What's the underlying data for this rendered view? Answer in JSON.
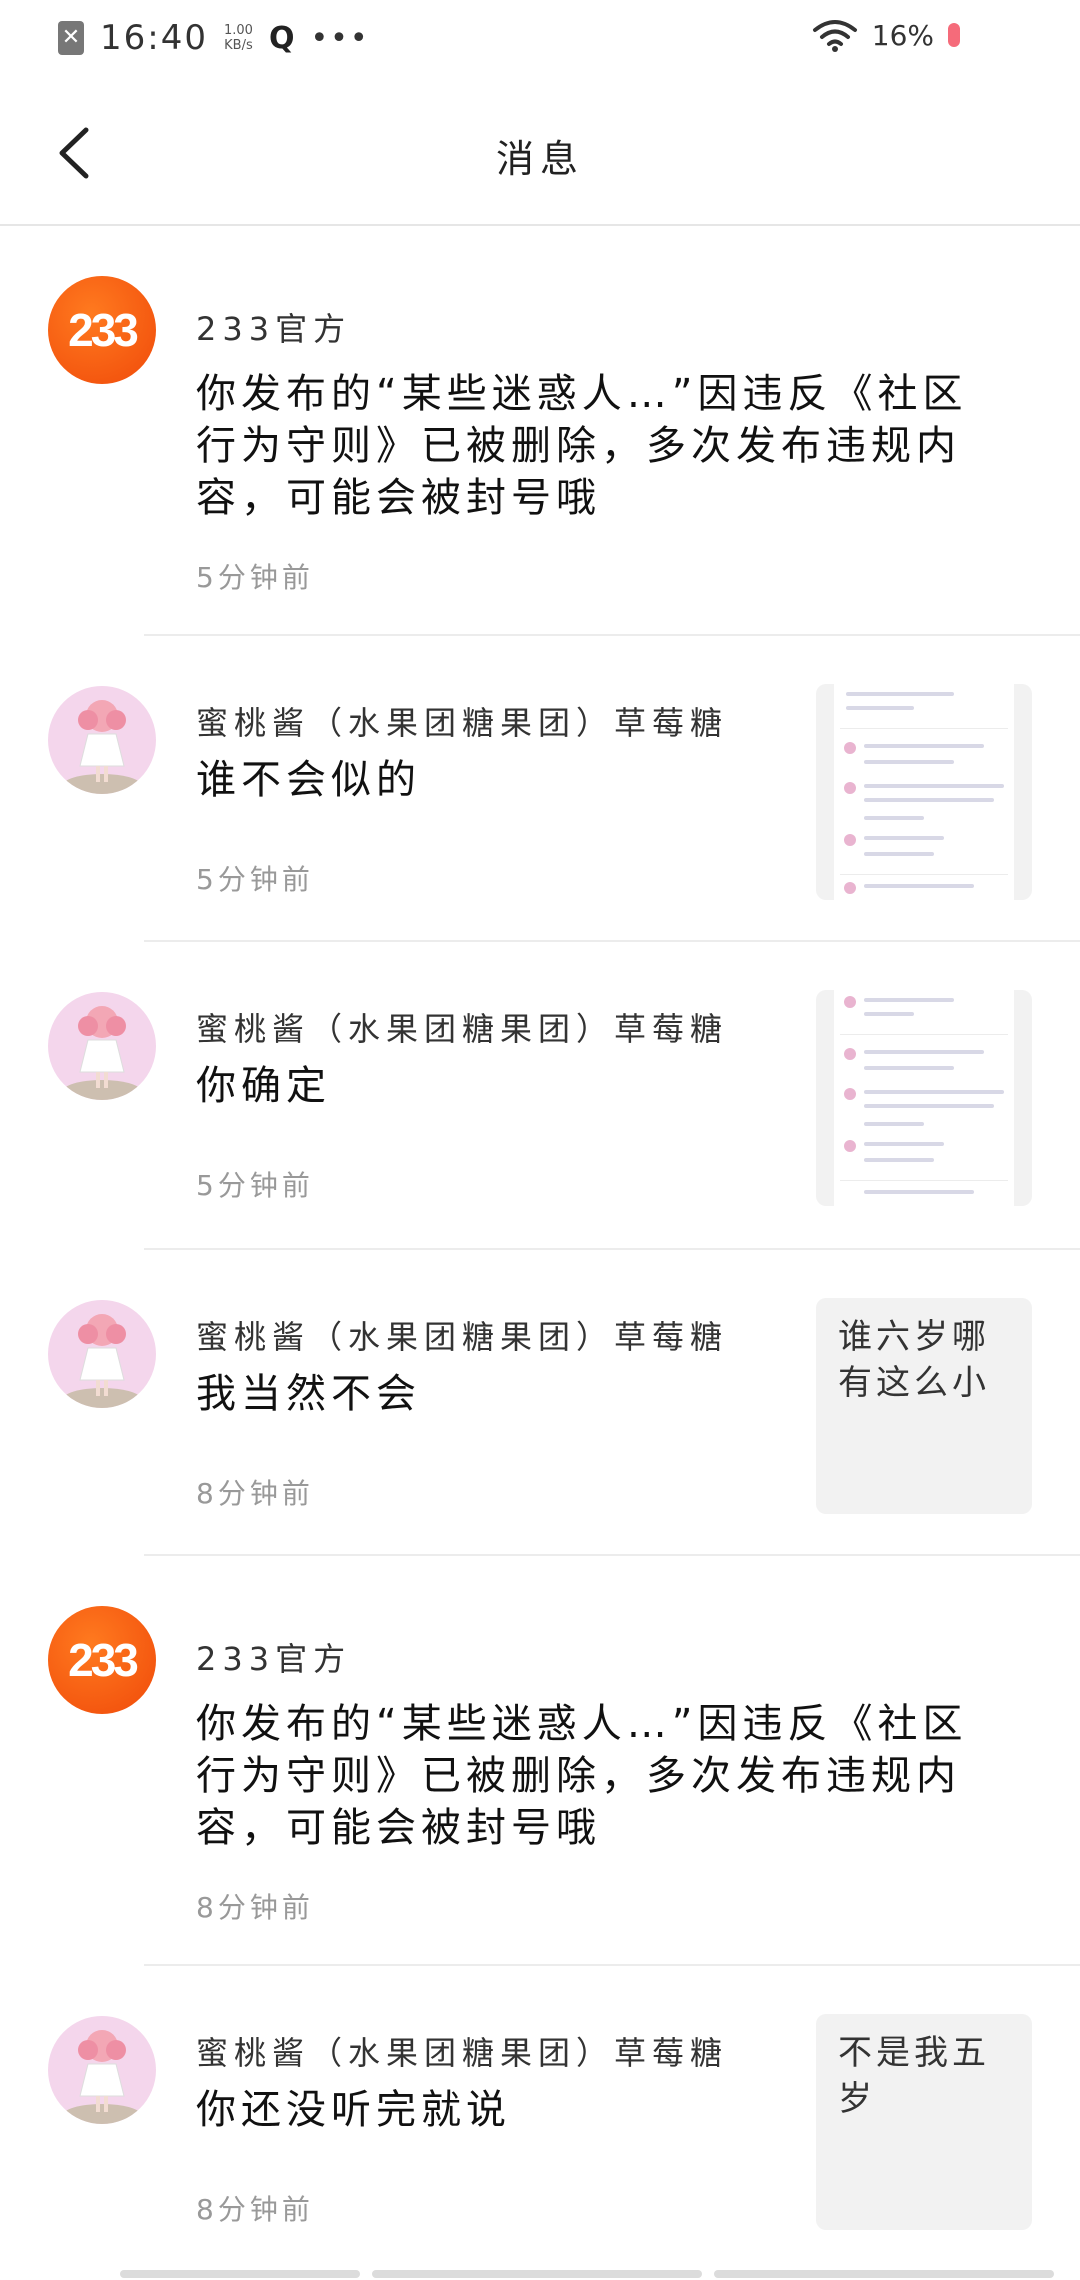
{
  "status_bar": {
    "time": "16:40",
    "speed_value": "1.00",
    "speed_unit": "KB/s",
    "battery": "16%"
  },
  "nav": {
    "title": "消息"
  },
  "messages": [
    {
      "sender": "233官方",
      "avatar": "233",
      "content": "你发布的“某些迷惑人…”因违反《社区行为守则》已被删除，多次发布违规内容，可能会被封号哦",
      "time": "5分钟前"
    },
    {
      "sender": "蜜桃酱（水果团糖果团）草莓糖",
      "content": "谁不会似的",
      "time": "5分钟前",
      "thumb_type": "screenshot"
    },
    {
      "sender": "蜜桃酱（水果团糖果团）草莓糖",
      "content": "你确定",
      "time": "5分钟前",
      "thumb_type": "screenshot"
    },
    {
      "sender": "蜜桃酱（水果团糖果团）草莓糖",
      "content": "我当然不会",
      "time": "8分钟前",
      "thumb_text": "谁六岁哪有这么小"
    },
    {
      "sender": "233官方",
      "avatar": "233",
      "content": "你发布的“某些迷惑人…”因违反《社区行为守则》已被删除，多次发布违规内容，可能会被封号哦",
      "time": "8分钟前"
    },
    {
      "sender": "蜜桃酱（水果团糖果团）草莓糖",
      "content": "你还没听完就说",
      "time": "8分钟前",
      "thumb_text": "不是我五岁"
    }
  ],
  "colors": {
    "brand_orange": "#f04a0a",
    "avatar_pink": "#f4d6ec",
    "divider": "#ececec"
  }
}
